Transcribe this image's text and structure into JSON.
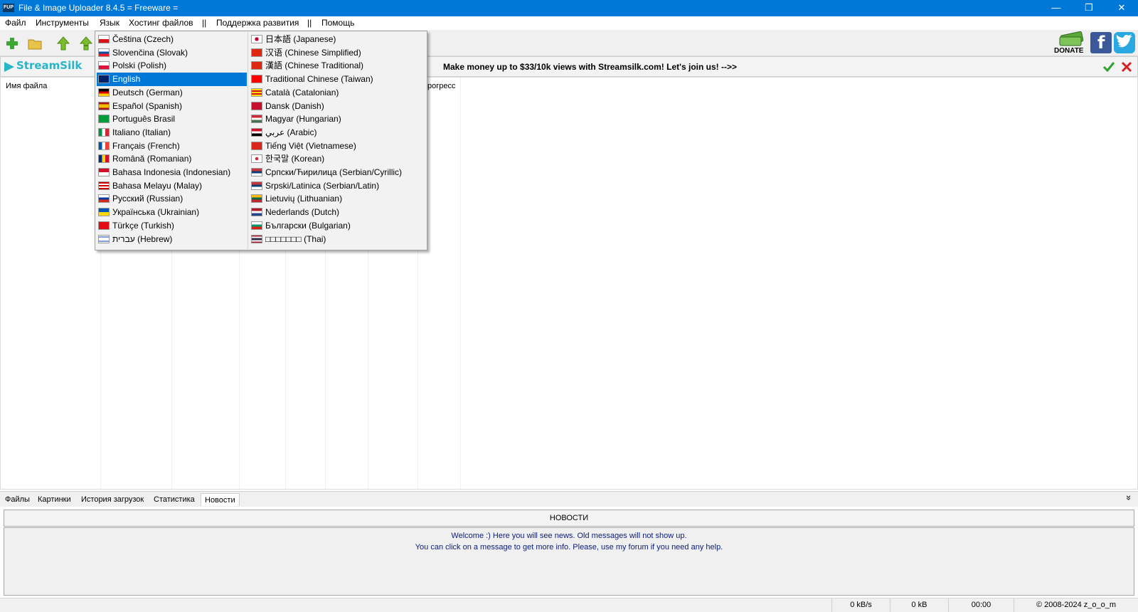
{
  "window": {
    "title": "File & Image Uploader 8.4.5  = Freeware =",
    "app_icon_text": "FUP",
    "minimize": "—",
    "restore": "❐",
    "close": "✕"
  },
  "menubar": [
    {
      "label": "Файл",
      "name": "menu-file"
    },
    {
      "label": "Инструменты",
      "name": "menu-tools"
    },
    {
      "label": "Язык",
      "name": "menu-language"
    },
    {
      "label": "Хостинг файлов",
      "name": "menu-file-hosting"
    },
    {
      "label": "||",
      "name": "menu-separator"
    },
    {
      "label": "Поддержка развития",
      "name": "menu-support-development"
    },
    {
      "label": "||",
      "name": "menu-separator"
    },
    {
      "label": "Помощь",
      "name": "menu-help"
    }
  ],
  "toolbar": {
    "buttons": [
      {
        "icon": "add-icon",
        "color": "#3fa535"
      },
      {
        "icon": "folder-icon",
        "color": "#e8c24a"
      },
      {
        "icon": "upload-icon",
        "color": "#7cbd2c"
      },
      {
        "icon": "upload-all-icon",
        "color": "#7cbd2c"
      }
    ],
    "donate_label": "DONATE"
  },
  "ad": {
    "logo": "StreamSilk",
    "text": "Make money up to $33/10k views with Streamsilk.com! Let's join us! -->>"
  },
  "list": {
    "col_file_name": "Имя файла",
    "col_progress": "рогресс"
  },
  "language_menu": {
    "left": [
      {
        "label": "Čeština (Czech)",
        "flag": "cz"
      },
      {
        "label": "Slovenčina (Slovak)",
        "flag": "sk"
      },
      {
        "label": "Polski (Polish)",
        "flag": "pl"
      },
      {
        "label": "English",
        "flag": "gb",
        "selected": true
      },
      {
        "label": "Deutsch (German)",
        "flag": "de"
      },
      {
        "label": "Español (Spanish)",
        "flag": "es"
      },
      {
        "label": "Português Brasil",
        "flag": "br"
      },
      {
        "label": "Italiano (Italian)",
        "flag": "it"
      },
      {
        "label": "Français (French)",
        "flag": "fr"
      },
      {
        "label": "Română (Romanian)",
        "flag": "ro"
      },
      {
        "label": "Bahasa Indonesia (Indonesian)",
        "flag": "id"
      },
      {
        "label": "Bahasa Melayu (Malay)",
        "flag": "my"
      },
      {
        "label": "Русский (Russian)",
        "flag": "ru"
      },
      {
        "label": "Українська (Ukrainian)",
        "flag": "ua"
      },
      {
        "label": "Türkçe (Turkish)",
        "flag": "tr"
      },
      {
        "label": "עברית (Hebrew)",
        "flag": "il"
      }
    ],
    "right": [
      {
        "label": "日本語 (Japanese)",
        "flag": "jp"
      },
      {
        "label": "汉语 (Chinese Simplified)",
        "flag": "cn"
      },
      {
        "label": "漢語 (Chinese Traditional)",
        "flag": "cn"
      },
      {
        "label": "Traditional Chinese (Taiwan)",
        "flag": "tw"
      },
      {
        "label": "Català (Catalonian)",
        "flag": "cat"
      },
      {
        "label": "Dansk (Danish)",
        "flag": "dk"
      },
      {
        "label": "Magyar (Hungarian)",
        "flag": "hu"
      },
      {
        "label": "عربي (Arabic)",
        "flag": "eg"
      },
      {
        "label": "Tiếng Việt (Vietnamese)",
        "flag": "vn"
      },
      {
        "label": "한국말 (Korean)",
        "flag": "kr"
      },
      {
        "label": "Српски/Ћирилица (Serbian/Cyrillic)",
        "flag": "rs"
      },
      {
        "label": "Srpski/Latinica (Serbian/Latin)",
        "flag": "rs"
      },
      {
        "label": "Lietuvių (Lithuanian)",
        "flag": "lt"
      },
      {
        "label": "Nederlands (Dutch)",
        "flag": "nl"
      },
      {
        "label": "Български (Bulgarian)",
        "flag": "bg"
      },
      {
        "label": "□□□□□□□ (Thai)",
        "flag": "th"
      }
    ]
  },
  "tabs": [
    {
      "label": "Файлы"
    },
    {
      "label": "Картинки"
    },
    {
      "label": "История загрузок"
    },
    {
      "label": "Статистика"
    },
    {
      "label": "Новости",
      "active": true
    }
  ],
  "collapse_glyph": "»",
  "news": {
    "header": "НОВОСТИ",
    "line1": "Welcome :) Here you will see news. Old messages will not show up.",
    "line2": "You can click on a message to get more info. Please, use my forum if you need any help."
  },
  "status": {
    "speed": "0 kB/s",
    "size": "0 kB",
    "time": "00:00",
    "copyright": "© 2008-2024 z_o_o_m"
  },
  "colors": {
    "titlebar": "#0078d7",
    "selection": "#0078d7",
    "news_text": "#0a1c7a"
  }
}
